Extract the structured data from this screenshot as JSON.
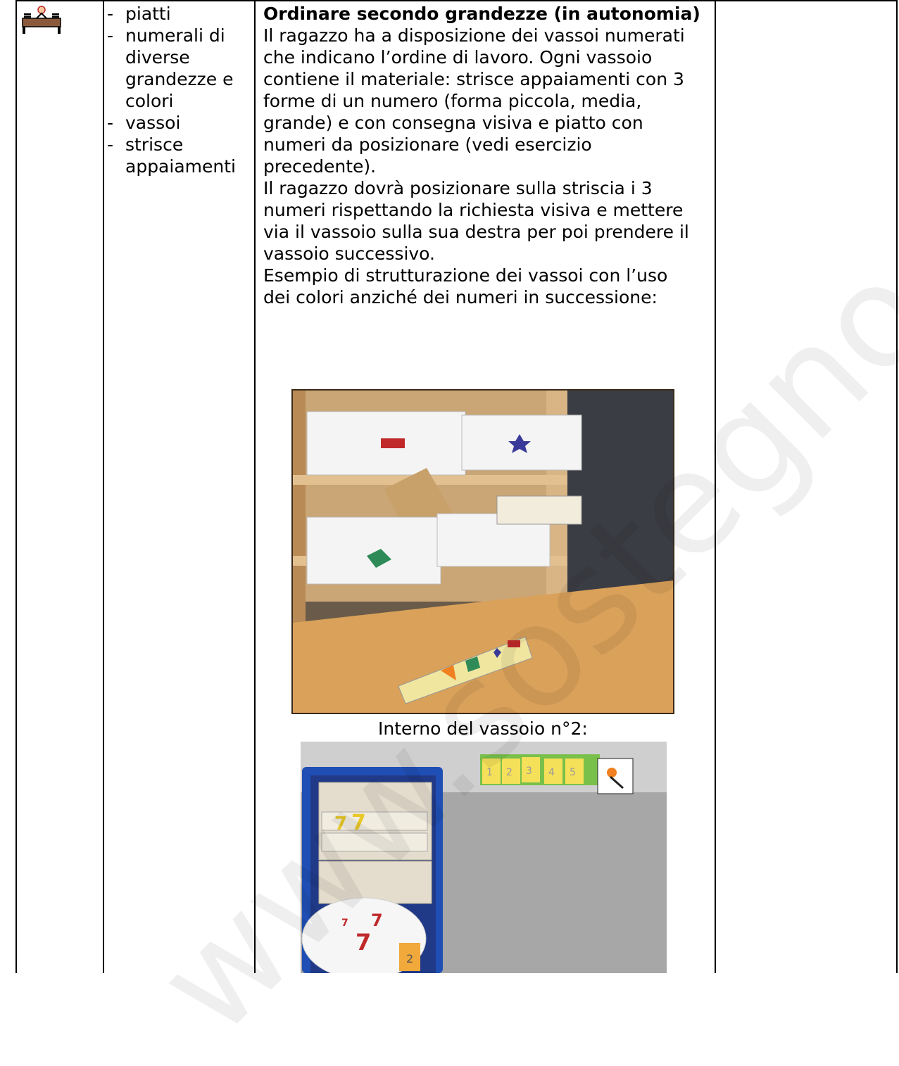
{
  "materials": {
    "items": [
      "piatti",
      "numerali di",
      "diverse",
      "grandezze e",
      "colori",
      "vassoi",
      "strisce",
      "appaiamenti"
    ],
    "bullets": [
      "-",
      "-",
      "-",
      "-"
    ]
  },
  "activity": {
    "title": "Ordinare secondo grandezze (in autonomia)",
    "lines": [
      "Il ragazzo ha a disposizione dei vassoi numerati",
      "che indicano l’ordine di lavoro. Ogni vassoio",
      "contiene il materiale: strisce appaiamenti con 3",
      "forme di un numero (forma piccola, media,",
      "grande) e con consegna visiva e piatto con",
      "numeri da posizionare (vedi esercizio",
      "precedente).",
      "Il ragazzo dovrà posizionare sulla striscia i 3",
      "numeri rispettando la richiesta visiva e mettere",
      "via il vassoio sulla sua destra per poi prendere il",
      "vassoio successivo.",
      "Esempio di strutturazione dei vassoi con l’uso",
      "dei colori anziché dei numeri in successione:"
    ],
    "caption": "Interno del vassoio n°2:",
    "tray_number": "2",
    "strip_numbers": [
      "1",
      "2",
      "3",
      "4",
      "5"
    ],
    "plate_digits": [
      "7",
      "7",
      "7"
    ],
    "board_digits": [
      "7",
      "7"
    ]
  },
  "watermark": "www.sostegno.dezioni.it",
  "colors": {
    "desk": "#8b5a3c",
    "tray": "#1f4fb5",
    "postit": "#f5e05a",
    "green_shape": "#2e8b57",
    "red_shape": "#c0282a"
  }
}
